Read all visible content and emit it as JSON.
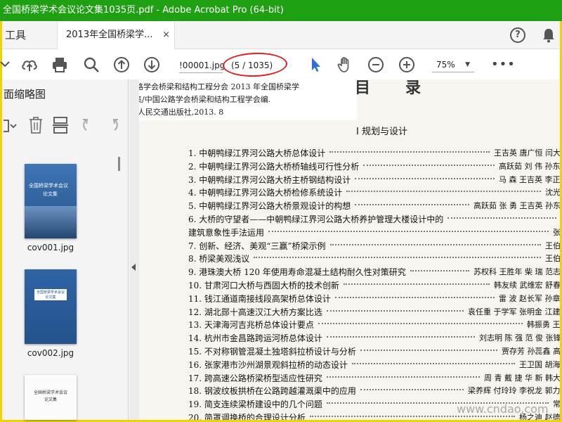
{
  "window": {
    "title": "全国桥梁学术会议论文集1035页.pdf - Adobe Acrobat Pro (64-bit)"
  },
  "tabs": {
    "tools": "工具",
    "document": "2013年全国桥梁学...",
    "close": "×"
  },
  "header_icons": {
    "help": "?"
  },
  "toolbar": {
    "page_input": "!00001.jpg",
    "page_count": "(5 / 1035)",
    "zoom": "75%",
    "more": "•••"
  },
  "sidebar": {
    "title": "面缩略图",
    "thumbnails": [
      {
        "label": "cov001.jpg",
        "cover_title": "全国桥梁学术会议",
        "cover_sub": "论文集"
      },
      {
        "label": "cov002.jpg",
        "cover_title": "全国桥梁学术会议",
        "cover_sub": "论文集"
      },
      {
        "label": "",
        "cover_title": "全国桥梁学术会议",
        "cover_sub": "论文集"
      }
    ]
  },
  "document": {
    "citation": [
      "中国公路学会桥梁和结构工程分会 2013 年全国桥梁学",
      "术会议论文集/中国公路学会桥梁和结构工程学会编.",
      "——北京:人民交通出版社,2013. 8"
    ],
    "heading_left": "目",
    "heading_right": "录",
    "section": "I   规划与设计",
    "toc": [
      {
        "title": "1. 中朝鸭绿江界河公路大桥总体设计",
        "authors": "王吉英   唐广恒   闫大"
      },
      {
        "title": "2. 中朝鸭绿江界河公路大桥桥轴线可行性分析",
        "authors": "高跃茹   刘   伟   孙东"
      },
      {
        "title": "3. 中朝鸭绿江界河公路大桥主桥钢结构设计",
        "authors": "马   森   王吉英   李正"
      },
      {
        "title": "4. 中朝鸭绿江界河公路大桥检修系统设计",
        "authors": "沈光"
      },
      {
        "title": "5. 中朝鸭绿江界河公路大桥景观设计的构想",
        "authors": "高跃茹   张   勇   王吉英   孙东"
      },
      {
        "title": "6. 大桥的守望者——中朝鸭绿江界河公路大桥养护管理大楼设计中的",
        "authors": ""
      },
      {
        "title": "              建筑意象性手法运用",
        "authors": "张"
      },
      {
        "title": "7. 创新、经济、美观“三赢”桥梁示例",
        "authors": "王伯"
      },
      {
        "title": "8. 桥梁美观浅议",
        "authors": "王伯"
      },
      {
        "title": "9. 港珠澳大桥 120 年使用寿命混凝土结构耐久性对策研究",
        "authors": "苏权科   王胜年   柴   瑞   范志"
      },
      {
        "title": "10. 甘肃河口大桥与西固大桥的技术创新",
        "authors": "韩友续   武维宏   舒春"
      },
      {
        "title": "11. 钱江通道南接线段高架桥总体设计",
        "authors": "雷   波   赵长军   孙章"
      },
      {
        "title": "12. 湖北郧十高速汉江大桥方案比选",
        "authors": "袁任重   于学军   张明金   江建"
      },
      {
        "title": "13. 天津海河吉兆桥总体设计要点",
        "authors": "韩振勇   王"
      },
      {
        "title": "14. 杭州市金昌路跨运河桥总体设计",
        "authors": "刘志明   陈   强   范   俊   张锋"
      },
      {
        "title": "15. 不对称钢管混凝土独塔斜拉桥设计与分析",
        "authors": "贾存芳   孙蕊鑫   高"
      },
      {
        "title": "16. 张家港市沙州湖景观斜拉桥的动态设计",
        "authors": "王卫国   胡海"
      },
      {
        "title": "17. 跨高速公路桥梁桥型适应性研究",
        "authors": "周   青   戴   捷   华   新   韩大"
      },
      {
        "title": "18. 钢波纹板拱桥在公路跨越灌溉渠中的应用",
        "authors": "梁养辉   付玲玲   李祝龙   郭力"
      },
      {
        "title": "19. 简支连续梁桥建设中的几个问题",
        "authors": "常   "
      },
      {
        "title": "20. 简罩调换桥的合理设计分析",
        "authors": "杨之迪   赵德"
      }
    ],
    "watermark": "www.cndao.com"
  },
  "colors": {
    "titlebar": "#1fa012",
    "frame": "#f2d200",
    "annotation_oval": "#e02222",
    "cursor": "#2f6fd6"
  }
}
